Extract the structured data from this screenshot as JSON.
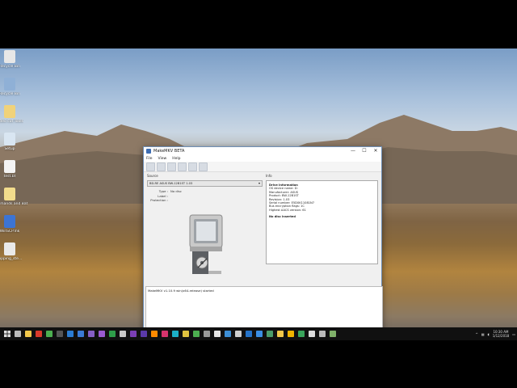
{
  "desktop": {
    "icons": [
      {
        "label": "Recycle Bin",
        "color": "#e7e7e7"
      },
      {
        "label": "Recycle Bin",
        "color": "#8fb0d6"
      },
      {
        "label": "Video cut Tools",
        "color": "#f0d27a"
      },
      {
        "label": "Setup",
        "color": "#d9e6f2"
      },
      {
        "label": "test.bt",
        "color": "#f4f4f4"
      },
      {
        "label": "Commands and Batch",
        "color": "#f2dc8c"
      },
      {
        "label": "WinSCP.lnk",
        "color": "#3c74d4"
      },
      {
        "label": "Ripping_ste...",
        "color": "#e9e9e9"
      }
    ]
  },
  "window": {
    "title": "MakeMKV BETA",
    "controls": {
      "minimize": "—",
      "maximize": "☐",
      "close": "✕"
    },
    "menu": [
      "File",
      "View",
      "Help"
    ],
    "toolbar_icons": [
      "open-files-icon",
      "open-disc-icon",
      "backup-icon",
      "stream-icon",
      "settings-icon",
      "eject-icon"
    ],
    "source": {
      "label": "Source",
      "drive_value": "BD-RE ASUS BW-12B1ST 1.03",
      "type_label": "Type :",
      "type_value": "No disc",
      "label_label": "Label :",
      "label_value": "",
      "protection_label": "Protection :",
      "protection_value": ""
    },
    "info": {
      "label": "Info",
      "heading": "Drive Information",
      "lines": [
        "OS device name: D:",
        "Manufacturer: ASUS",
        "Product: BW-12B1ST",
        "Revision: 1.03",
        "Serial number: E5D0K11081N7",
        "Bus encryption flags: 1C",
        "Highest AACS version: 61"
      ],
      "no_disc": "No disc inserted"
    },
    "log": "MakeMKV v1.10.9 win(x64-release) started"
  },
  "taskbar": {
    "start_icon": "windows-start-icon",
    "apps": [
      {
        "name": "task-view",
        "color": "#bbbbbb"
      },
      {
        "name": "file-explorer",
        "color": "#f2c84b"
      },
      {
        "name": "red-app",
        "color": "#d93a2b"
      },
      {
        "name": "chrome",
        "color": "#4caf50"
      },
      {
        "name": "terminal",
        "color": "#555555"
      },
      {
        "name": "azure",
        "color": "#2b7cd3"
      },
      {
        "name": "edge",
        "color": "#3b7bd6"
      },
      {
        "name": "vs",
        "color": "#865fc5"
      },
      {
        "name": "premiere",
        "color": "#9a5bd1"
      },
      {
        "name": "green-app",
        "color": "#2e9e4a"
      },
      {
        "name": "media",
        "color": "#c9c9c9"
      },
      {
        "name": "onenote",
        "color": "#7b3fb5"
      },
      {
        "name": "purple-app",
        "color": "#5a3aa8"
      },
      {
        "name": "illustrator",
        "color": "#ff8a00"
      },
      {
        "name": "indesign",
        "color": "#d6346d"
      },
      {
        "name": "cyan-app",
        "color": "#1cb0c7"
      },
      {
        "name": "yellow-app",
        "color": "#e0c340"
      },
      {
        "name": "chrome-2",
        "color": "#4caf50"
      },
      {
        "name": "gray-app",
        "color": "#9a9a9a"
      },
      {
        "name": "calculator",
        "color": "#e6e6e6"
      },
      {
        "name": "code",
        "color": "#3d8fd6"
      },
      {
        "name": "settings",
        "color": "#d0d0d0"
      },
      {
        "name": "blue-app",
        "color": "#2573c9"
      },
      {
        "name": "mail",
        "color": "#3b8ee3"
      },
      {
        "name": "globe",
        "color": "#4b9c6a"
      },
      {
        "name": "folder",
        "color": "#f2c84b"
      },
      {
        "name": "warning",
        "color": "#f0b400"
      },
      {
        "name": "green-2",
        "color": "#3aa55c"
      },
      {
        "name": "fox",
        "color": "#dddddd"
      },
      {
        "name": "steam",
        "color": "#bbbbbb"
      },
      {
        "name": "makemkv",
        "color": "#7fb069"
      }
    ],
    "time": "10:30 AM",
    "date": "1/12/2018"
  },
  "colors": {
    "titlebar_border": "#6f8fb6",
    "taskbar": "#101010"
  }
}
